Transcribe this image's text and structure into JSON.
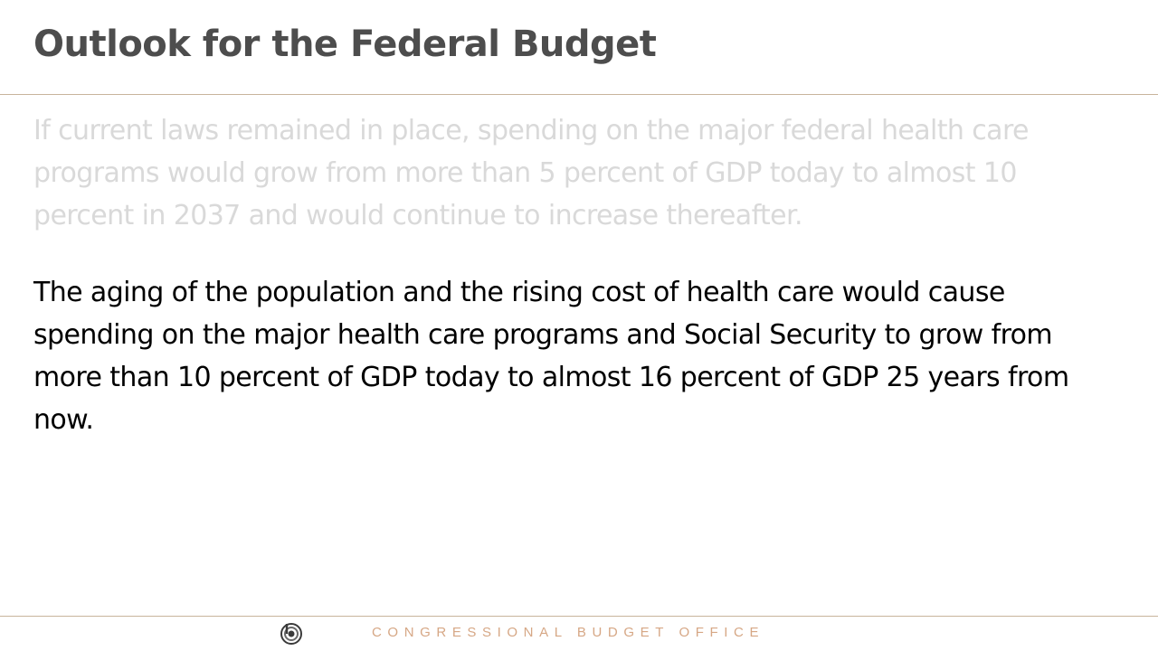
{
  "slide": {
    "title": "Outlook for the Federal Budget",
    "paragraphs": {
      "faded": "If current laws remained in place, spending on the major federal health care programs would grow from more than 5 percent of GDP today to almost 10 percent in 2037 and would continue to increase thereafter.",
      "main": "The aging of the population and the rising cost of health care would cause spending on the major health care programs and Social Security to grow from more than 10 percent of GDP today to almost 16 percent of GDP 25 years from now."
    },
    "footer": {
      "organization": "CONGRESSIONAL BUDGET OFFICE",
      "logo_icon": "cbo-logo-icon"
    }
  },
  "colors": {
    "title": "#4d4d4d",
    "faded_text": "#d9d9d9",
    "body_text": "#000000",
    "rule": "#c8b49c",
    "footer_text": "#d6a785"
  }
}
